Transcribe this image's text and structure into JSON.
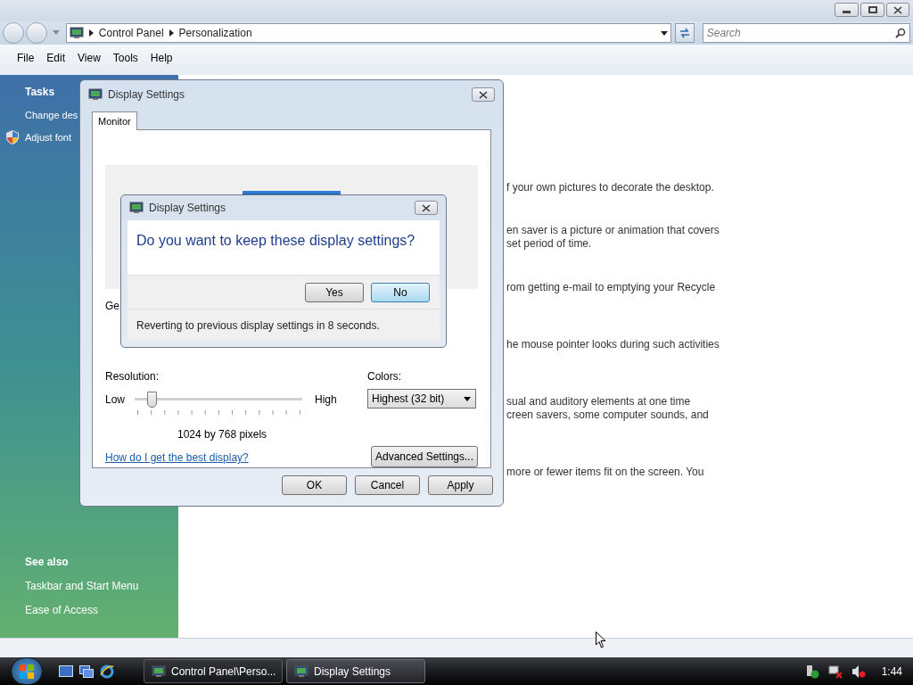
{
  "window": {
    "breadcrumb": [
      "Control Panel",
      "Personalization"
    ],
    "search": {
      "placeholder": "Search"
    },
    "menu": [
      "File",
      "Edit",
      "View",
      "Tools",
      "Help"
    ]
  },
  "sidebar": {
    "tasks_heading": "Tasks",
    "tasks": [
      {
        "label": "Change des",
        "kind": "link"
      },
      {
        "label": "Adjust font",
        "kind": "shield"
      }
    ],
    "see_also_heading": "See also",
    "see_also": [
      "Taskbar and Start Menu",
      "Ease of Access"
    ]
  },
  "content": {
    "paragraphs": [
      [
        "f your own pictures to decorate the desktop."
      ],
      [
        "en saver is a picture or animation that covers",
        "set period of time."
      ],
      [
        "rom getting e-mail to emptying your Recycle"
      ],
      [
        "he mouse pointer looks during such activities"
      ],
      [
        "sual and auditory elements at one time",
        "creen savers, some computer sounds, and"
      ],
      [
        "more or fewer items fit on the screen. You"
      ]
    ]
  },
  "display_dialog": {
    "title": "Display Settings",
    "tabs": [
      {
        "label": "Monitor",
        "selected": true
      }
    ],
    "monitor_label": "Ge",
    "resolution": {
      "label": "Resolution:",
      "low": "Low",
      "high": "High",
      "level": 0.08,
      "reading": "1024 by 768 pixels"
    },
    "colors": {
      "label": "Colors:",
      "value": "Highest (32 bit)"
    },
    "help_link": "How do I get the best display?",
    "advanced_button": "Advanced Settings...",
    "buttons": [
      {
        "label": "OK",
        "default": false
      },
      {
        "label": "Cancel",
        "default": false
      },
      {
        "label": "Apply",
        "default": false
      }
    ]
  },
  "confirm_dialog": {
    "title": "Display Settings",
    "question": "Do you want to keep these display settings?",
    "buttons": [
      {
        "label": "Yes",
        "default": false
      },
      {
        "label": "No",
        "default": true
      }
    ],
    "footer": "Reverting to previous display settings in 8 seconds."
  },
  "taskbar": {
    "buttons": [
      {
        "label": "Control Panel\\Perso...",
        "selected": false
      },
      {
        "label": "Display Settings",
        "selected": true
      }
    ],
    "clock": "1:44"
  }
}
